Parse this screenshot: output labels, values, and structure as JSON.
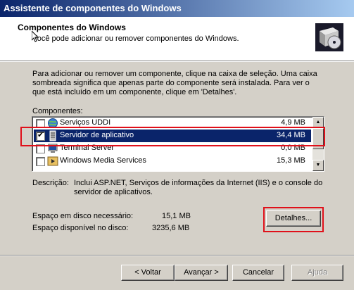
{
  "window": {
    "title": "Assistente de componentes do Windows"
  },
  "header": {
    "title": "Componentes do Windows",
    "subtitle": "Você pode adicionar ou remover componentes do Windows."
  },
  "instructions": "Para adicionar ou remover um componente, clique na caixa de seleção. Uma caixa sombreada significa que apenas parte do componente será instalada. Para ver o que está incluído em um componente, clique em 'Detalhes'.",
  "components": {
    "label": "Componentes:",
    "items": [
      {
        "label": "Serviços UDDI",
        "size": "4,9 MB",
        "checked": false,
        "selected": false,
        "icon": "uddi-globe-icon"
      },
      {
        "label": "Servidor de aplicativo",
        "size": "34,4 MB",
        "checked": true,
        "selected": true,
        "icon": "app-server-icon"
      },
      {
        "label": "Terminal Server",
        "size": "0,0 MB",
        "checked": false,
        "selected": false,
        "icon": "terminal-server-icon"
      },
      {
        "label": "Windows Media Services",
        "size": "15,3 MB",
        "checked": false,
        "selected": false,
        "icon": "media-services-icon"
      }
    ]
  },
  "description": {
    "label": "Descrição:",
    "text": "Inclui ASP.NET, Serviços de informações da Internet (IIS) e o console do servidor de aplicativos."
  },
  "disk": {
    "required_label": "Espaço em disco necessário:",
    "required_value": "15,1 MB",
    "available_label": "Espaço disponível no disco:",
    "available_value": "3235,6 MB"
  },
  "buttons": {
    "details": "Detalhes...",
    "back": "< Voltar",
    "next": "Avançar >",
    "cancel": "Cancelar",
    "help": "Ajuda"
  },
  "colors": {
    "selection": "#0a246a",
    "highlight_annotation": "#e0101a",
    "face": "#d4d0c8"
  }
}
